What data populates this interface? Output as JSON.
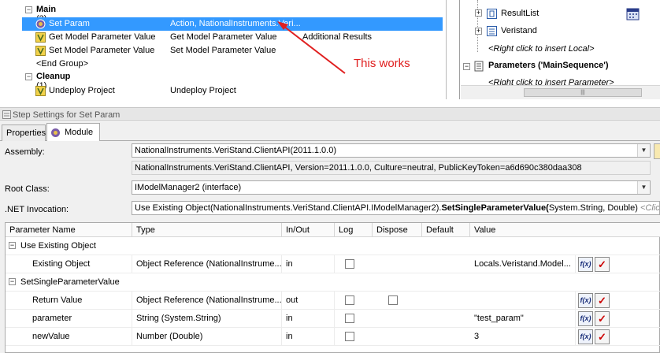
{
  "sequence": {
    "groups": [
      {
        "label": "Main",
        "count": "(3)"
      },
      {
        "label": "Cleanup",
        "count": "(1)"
      }
    ],
    "steps": [
      {
        "name": "Set Param",
        "description": "Action,  NationalInstruments.Veri...",
        "extra": "",
        "selected": true
      },
      {
        "name": "Get Model Parameter Value",
        "description": "Get Model Parameter Value",
        "extra": "Additional Results"
      },
      {
        "name": "Set Model Parameter Value",
        "description": "Set Model Parameter Value",
        "extra": ""
      },
      {
        "name": "<End Group>",
        "description": "",
        "extra": ""
      },
      {
        "name": "Undeploy Project",
        "description": "Undeploy Project",
        "extra": ""
      }
    ],
    "annotation": "This works"
  },
  "variables": {
    "items": [
      "ResultList",
      "Veristand"
    ],
    "insert_local": "<Right click to insert Local>",
    "parameters_label": "Parameters ('MainSequence')",
    "insert_param": "<Right click to insert Parameter>"
  },
  "settings": {
    "title": "Step Settings for Set Param",
    "tabs": [
      "Properties",
      "Module"
    ],
    "assembly_label": "Assembly:",
    "assembly_value": "NationalInstruments.VeriStand.ClientAPI(2011.1.0.0)",
    "assembly_full": "NationalInstruments.VeriStand.ClientAPI, Version=2011.1.0.0, Culture=neutral, PublicKeyToken=a6d690c380daa308",
    "root_class_label": "Root Class:",
    "root_class_value": "IModelManager2 (interface)",
    "invocation_label": ".NET Invocation:",
    "invocation_prefix": "Use Existing Object(NationalInstruments.VeriStand.ClientAPI.IModelManager2).",
    "invocation_method": "SetSingleParameterValue(",
    "invocation_suffix": "System.String, Double)",
    "invocation_hint": " <Click H"
  },
  "grid": {
    "columns": [
      "Parameter Name",
      "Type",
      "In/Out",
      "Log",
      "Dispose",
      "Default",
      "Value"
    ],
    "sections": [
      "Use Existing Object",
      "SetSingleParameterValue"
    ],
    "rows": [
      {
        "name": "Existing Object",
        "type": "Object Reference (NationalInstrume...",
        "inout": "in",
        "value": "Locals.Veristand.Model...",
        "dispose": false
      },
      {
        "name": "Return Value",
        "type": "Object Reference (NationalInstrume...",
        "inout": "out",
        "value": "",
        "dispose": true
      },
      {
        "name": "parameter",
        "type": "String (System.String)",
        "inout": "in",
        "value": "\"test_param\"",
        "dispose": false
      },
      {
        "name": "newValue",
        "type": "Number (Double)",
        "inout": "in",
        "value": "3",
        "dispose": false
      }
    ],
    "fx_label": "f(x)",
    "check_label": "✓"
  },
  "colors": {
    "selection": "#3399ff",
    "annotation": "#e02020"
  }
}
